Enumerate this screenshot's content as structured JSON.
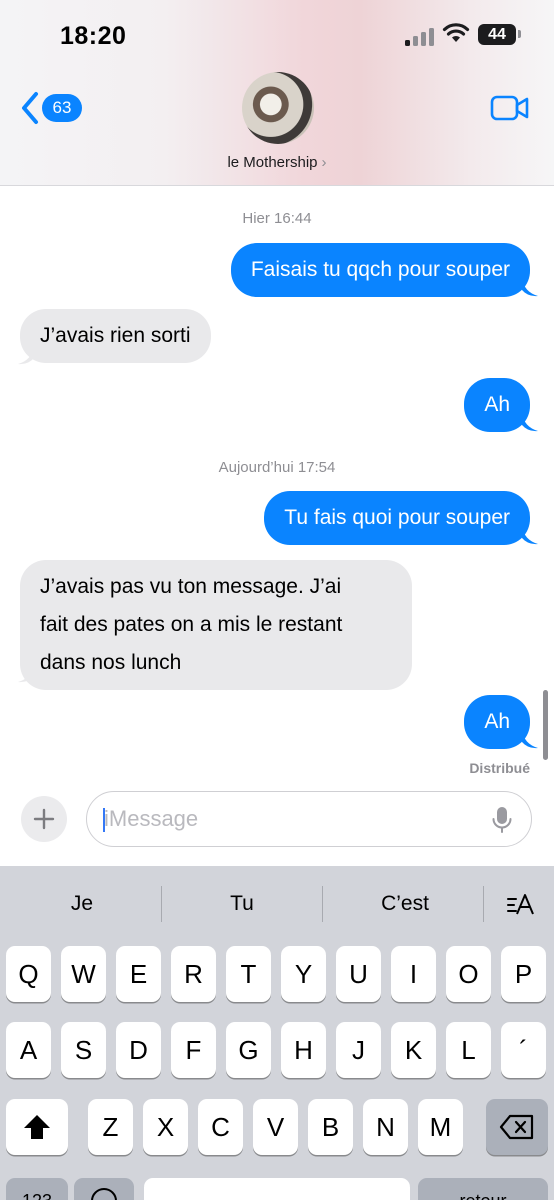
{
  "status_bar": {
    "time": "18:20",
    "battery": "44"
  },
  "header": {
    "back_count": "63",
    "contact_name": "le Mothership",
    "contact_chevron": "›"
  },
  "messages": [
    {
      "type": "timestamp",
      "text": "Hier 16:44"
    },
    {
      "type": "sent",
      "text": "Faisais tu qqch pour souper"
    },
    {
      "type": "received",
      "text": "J’avais rien sorti"
    },
    {
      "type": "sent",
      "text": "Ah"
    },
    {
      "type": "timestamp",
      "text": "Aujourd’hui 17:54"
    },
    {
      "type": "sent",
      "text": "Tu fais quoi pour souper"
    },
    {
      "type": "received",
      "lines": [
        "J’avais pas vu ton message. J’ai",
        "fait des pates on a mis le restant",
        "dans nos lunch"
      ]
    },
    {
      "type": "sent",
      "text": "Ah"
    }
  ],
  "delivery_status": "Distribué",
  "composer": {
    "placeholder": "iMessage"
  },
  "keyboard": {
    "suggestions": [
      "Je",
      "Tu",
      "C’est"
    ],
    "row1": [
      "Q",
      "W",
      "E",
      "R",
      "T",
      "Y",
      "U",
      "I",
      "O",
      "P"
    ],
    "row2": [
      "A",
      "S",
      "D",
      "F",
      "G",
      "H",
      "J",
      "K",
      "L",
      "´"
    ],
    "row3": [
      "Z",
      "X",
      "C",
      "V",
      "B",
      "N",
      "M"
    ],
    "row4": {
      "numbers": "123",
      "return": "retour"
    }
  },
  "colors": {
    "sent_bubble": "#0a84ff",
    "received_bubble": "#e9e9eb",
    "accent": "#0a84ff"
  }
}
